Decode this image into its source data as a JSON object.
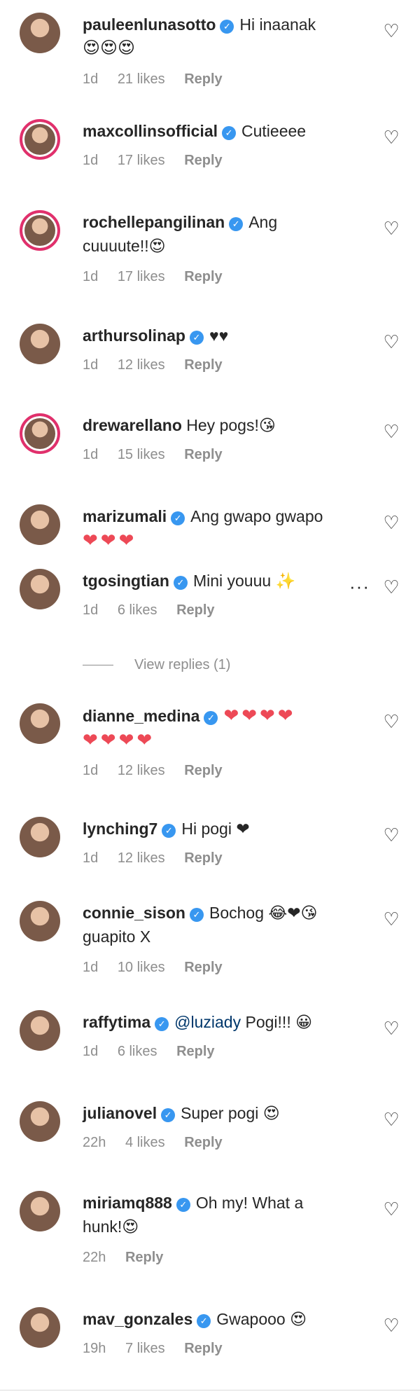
{
  "comments": [
    {
      "username": "pauleenlunasotto",
      "text": "Hi inaanak",
      "line2": "😍😍😍",
      "time": "1d",
      "likes": "21 likes",
      "reply": "Reply",
      "ring": false
    },
    {
      "username": "maxcollinsofficial",
      "text": "Cutieeee",
      "line2": "",
      "time": "1d",
      "likes": "17 likes",
      "reply": "Reply",
      "ring": true
    },
    {
      "username": "rochellepangilinan",
      "text": "Ang",
      "line2": "cuuuute!!😍",
      "time": "1d",
      "likes": "17 likes",
      "reply": "Reply",
      "ring": true
    },
    {
      "username": "arthursolinap",
      "text": "♥♥",
      "line2": "",
      "time": "1d",
      "likes": "12 likes",
      "reply": "Reply",
      "ring": false
    },
    {
      "username": "drewarellano",
      "text": "Hey pogs!😘",
      "line2": "",
      "time": "1d",
      "likes": "15 likes",
      "reply": "Reply",
      "ring": true
    },
    {
      "username": "marizumali",
      "text": "Ang gwapo gwapo",
      "line2": "❤❤❤",
      "time": "",
      "likes": "",
      "reply": "",
      "ring": false
    },
    {
      "username": "tgosingtian",
      "text": "Mini youuu ✨",
      "line2": "",
      "time": "1d",
      "likes": "6 likes",
      "reply": "Reply",
      "ring": false
    },
    {
      "username": "dianne_medina",
      "text": "❤❤❤❤",
      "line2": "❤❤❤❤",
      "time": "1d",
      "likes": "12 likes",
      "reply": "Reply",
      "ring": false
    },
    {
      "username": "lynching7",
      "text": "Hi pogi ❤",
      "line2": "",
      "time": "1d",
      "likes": "12 likes",
      "reply": "Reply",
      "ring": false
    },
    {
      "username": "connie_sison",
      "text": "Bochog 😂❤😘",
      "line2": "guapito X",
      "time": "1d",
      "likes": "10 likes",
      "reply": "Reply",
      "ring": false
    },
    {
      "username": "raffytima",
      "mention": "@luziady",
      "text": "Pogi!!! 😀",
      "line2": "",
      "time": "1d",
      "likes": "6 likes",
      "reply": "Reply",
      "ring": false
    },
    {
      "username": "julianovel",
      "text": "Super pogi 😍",
      "line2": "",
      "time": "22h",
      "likes": "4 likes",
      "reply": "Reply",
      "ring": false
    },
    {
      "username": "miriamq888",
      "text": "Oh my! What a",
      "line2": "hunk!😍",
      "time": "22h",
      "likes": "",
      "reply": "Reply",
      "ring": false
    },
    {
      "username": "mav_gonzales",
      "text": "Gwapooo 😍",
      "line2": "",
      "time": "19h",
      "likes": "7 likes",
      "reply": "Reply",
      "ring": false
    }
  ],
  "more_icon": "···",
  "heart_icon": "♡",
  "view_replies": "View replies (1)"
}
